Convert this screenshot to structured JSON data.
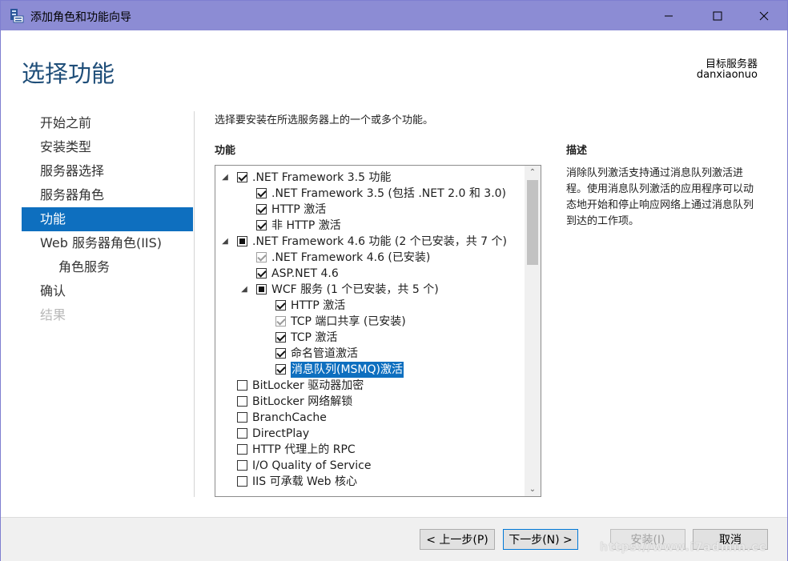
{
  "window": {
    "title": "添加角色和功能向导",
    "colors": {
      "titlebar": "#8c8cd4",
      "accent": "#0e6fbf",
      "page_title": "#1f4e79"
    }
  },
  "header": {
    "page_title": "选择功能",
    "target_label": "目标服务器",
    "target_name": "danxiaonuo"
  },
  "nav": {
    "items": [
      {
        "label": "开始之前",
        "state": "normal"
      },
      {
        "label": "安装类型",
        "state": "normal"
      },
      {
        "label": "服务器选择",
        "state": "normal"
      },
      {
        "label": "服务器角色",
        "state": "normal"
      },
      {
        "label": "功能",
        "state": "active"
      },
      {
        "label": "Web 服务器角色(IIS)",
        "state": "normal"
      },
      {
        "label": "角色服务",
        "state": "sub"
      },
      {
        "label": "确认",
        "state": "normal"
      },
      {
        "label": "结果",
        "state": "disabled"
      }
    ]
  },
  "main": {
    "instruction": "选择要安装在所选服务器上的一个或多个功能。",
    "features_heading": "功能",
    "description_heading": "描述",
    "description": "消除队列激活支持通过消息队列激活进程。使用消息队列激活的应用程序可以动态地开始和停止响应网络上通过消息队列到达的工作项。"
  },
  "tree": [
    {
      "label": ".NET Framework 3.5 功能",
      "level": 0,
      "expander": "expanded",
      "check": "checked"
    },
    {
      "label": ".NET Framework 3.5 (包括 .NET 2.0 和 3.0)",
      "level": 1,
      "expander": "none",
      "check": "checked"
    },
    {
      "label": "HTTP 激活",
      "level": 1,
      "expander": "none",
      "check": "checked"
    },
    {
      "label": "非 HTTP 激活",
      "level": 1,
      "expander": "none",
      "check": "checked"
    },
    {
      "label": ".NET Framework 4.6 功能 (2 个已安装，共 7 个)",
      "level": 0,
      "expander": "expanded",
      "check": "partial"
    },
    {
      "label": ".NET Framework 4.6 (已安装)",
      "level": 1,
      "expander": "none",
      "check": "checked-disabled"
    },
    {
      "label": "ASP.NET 4.6",
      "level": 1,
      "expander": "none",
      "check": "checked"
    },
    {
      "label": "WCF 服务 (1 个已安装，共 5 个)",
      "level": 1,
      "expander": "expanded",
      "check": "partial"
    },
    {
      "label": "HTTP 激活",
      "level": 2,
      "expander": "none",
      "check": "checked"
    },
    {
      "label": "TCP 端口共享 (已安装)",
      "level": 2,
      "expander": "none",
      "check": "checked-disabled"
    },
    {
      "label": "TCP 激活",
      "level": 2,
      "expander": "none",
      "check": "checked"
    },
    {
      "label": "命名管道激活",
      "level": 2,
      "expander": "none",
      "check": "checked"
    },
    {
      "label": "消息队列(MSMQ)激活",
      "level": 2,
      "expander": "none",
      "check": "checked",
      "selected": true
    },
    {
      "label": "BitLocker 驱动器加密",
      "level": 0,
      "expander": "none",
      "check": "unchecked"
    },
    {
      "label": "BitLocker 网络解锁",
      "level": 0,
      "expander": "none",
      "check": "unchecked"
    },
    {
      "label": "BranchCache",
      "level": 0,
      "expander": "none",
      "check": "unchecked"
    },
    {
      "label": "DirectPlay",
      "level": 0,
      "expander": "none",
      "check": "unchecked"
    },
    {
      "label": "HTTP 代理上的 RPC",
      "level": 0,
      "expander": "none",
      "check": "unchecked"
    },
    {
      "label": "I/O Quality of Service",
      "level": 0,
      "expander": "none",
      "check": "unchecked"
    },
    {
      "label": "IIS 可承载 Web 核心",
      "level": 0,
      "expander": "none",
      "check": "unchecked"
    }
  ],
  "footer": {
    "prev_label": "< 上一步(P)",
    "next_label": "下一步(N) >",
    "install_label": "安装(I)",
    "cancel_label": "取消"
  },
  "watermark": "https://www.i7admin.cc"
}
